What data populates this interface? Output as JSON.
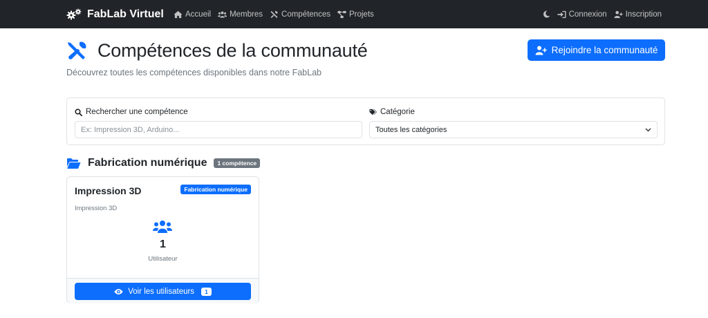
{
  "navbar": {
    "brand": "FabLab Virtuel",
    "brand_icon": "gears-icon",
    "links": [
      {
        "label": "Accueil",
        "icon": "home-icon"
      },
      {
        "label": "Membres",
        "icon": "users-icon"
      },
      {
        "label": "Compétences",
        "icon": "tools-icon"
      },
      {
        "label": "Projets",
        "icon": "project-diagram-icon"
      }
    ],
    "right": [
      {
        "label": "Connexion",
        "icon": "sign-in-icon"
      },
      {
        "label": "Inscription",
        "icon": "user-plus-icon"
      }
    ],
    "theme_icon": "moon-icon"
  },
  "header": {
    "title": "Compétences de la communauté",
    "subtitle": "Découvrez toutes les compétences disponibles dans notre FabLab",
    "title_icon": "tools-icon",
    "join_button": "Rejoindre la communauté"
  },
  "filters": {
    "search_label": "Rechercher une compétence",
    "search_placeholder": "Ex: Impression 3D, Arduino...",
    "category_label": "Catégorie",
    "category_selected": "Toutes les catégories"
  },
  "categories": [
    {
      "name": "Fabrication numérique",
      "count_badge": "1 compétence",
      "skills": [
        {
          "title": "Impression 3D",
          "badge": "Fabrication numérique",
          "description": "Impression 3D",
          "user_count": "1",
          "user_label": "Utilisateur",
          "view_button": "Voir les utilisateurs",
          "view_count": "1"
        }
      ]
    }
  ],
  "colors": {
    "primary": "#0d6efd",
    "navbar_bg": "#212529",
    "muted": "#6c757d",
    "secondary_badge": "#6c757d"
  }
}
